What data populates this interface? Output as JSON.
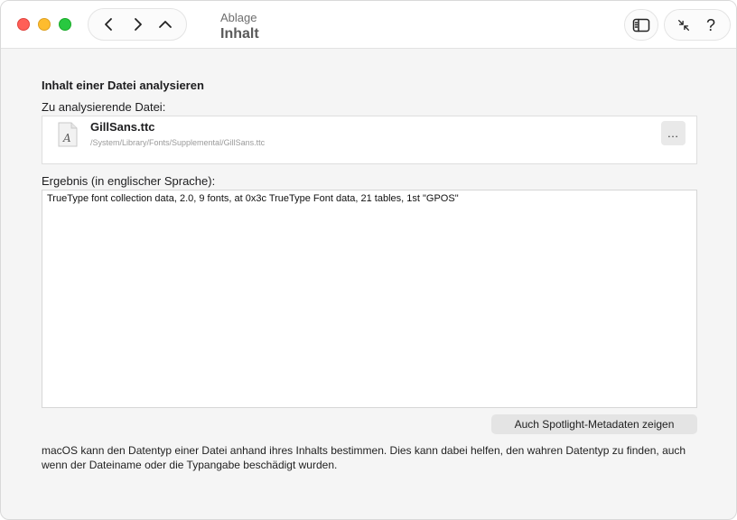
{
  "window": {
    "breadcrumb": "Ablage",
    "title": "Inhalt"
  },
  "toolbar": {
    "icons": [
      "chevron-left-icon",
      "chevron-right-icon",
      "chevron-up-icon",
      "sidebar-icon",
      "collapse-icon",
      "help-icon"
    ],
    "help_glyph": "?"
  },
  "content": {
    "section_title": "Inhalt einer Datei analysieren",
    "file_label": "Zu analysierende Datei:",
    "file": {
      "name": "GillSans.ttc",
      "path": "/System/Library/Fonts/Supplemental/GillSans.ttc",
      "more_label": "…"
    },
    "result_label": "Ergebnis (in englischer Sprache):",
    "result_text": "TrueType font collection data, 2.0, 9 fonts, at 0x3c TrueType Font data, 21 tables, 1st \"GPOS\"",
    "spotlight_button": "Auch Spotlight-Metadaten zeigen",
    "footer": "macOS kann den Datentyp einer Datei anhand ihres Inhalts bestimmen. Dies kann dabei helfen, den wahren Datentyp zu finden, auch wenn der Dateiname oder die Typangabe beschädigt wurden."
  },
  "colors": {
    "traffic_close": "#ff5f57",
    "traffic_minimize": "#febc2e",
    "traffic_maximize": "#28c840"
  }
}
